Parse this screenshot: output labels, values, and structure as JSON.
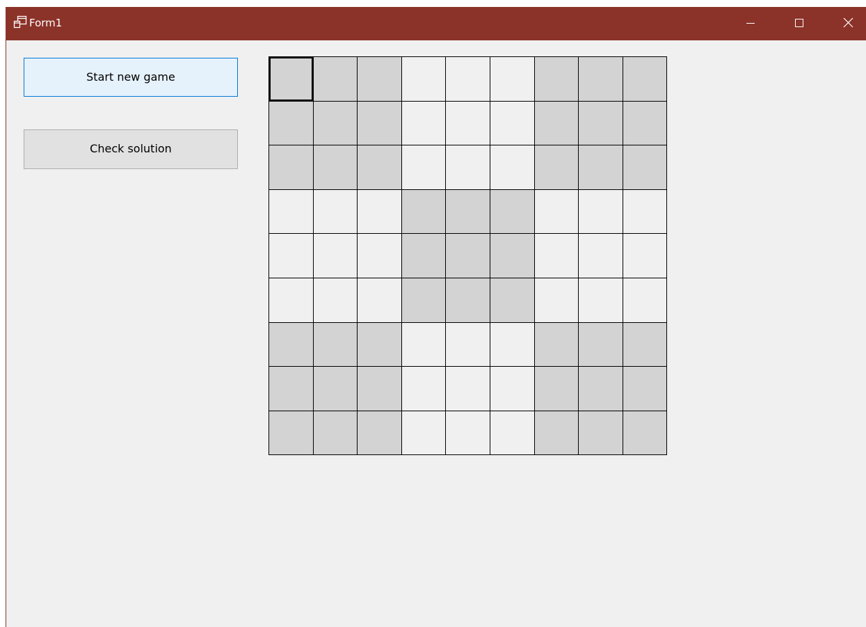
{
  "window": {
    "title": "Form1",
    "icon": "window-app-icon",
    "titlebar_color": "#8b3229",
    "controls": {
      "minimize_icon": "minimize-icon",
      "maximize_icon": "maximize-icon",
      "close_icon": "close-icon"
    }
  },
  "buttons": {
    "start_new_game": "Start new game",
    "check_solution": "Check solution"
  },
  "board": {
    "rows": 9,
    "cols": 9,
    "shaded_color": "#d3d3d3",
    "plain_color": "#f0f0f0",
    "selected_cell": [
      0,
      0
    ],
    "cell_values": [
      [
        "",
        "",
        "",
        "",
        "",
        "",
        "",
        "",
        ""
      ],
      [
        "",
        "",
        "",
        "",
        "",
        "",
        "",
        "",
        ""
      ],
      [
        "",
        "",
        "",
        "",
        "",
        "",
        "",
        "",
        ""
      ],
      [
        "",
        "",
        "",
        "",
        "",
        "",
        "",
        "",
        ""
      ],
      [
        "",
        "",
        "",
        "",
        "",
        "",
        "",
        "",
        ""
      ],
      [
        "",
        "",
        "",
        "",
        "",
        "",
        "",
        "",
        ""
      ],
      [
        "",
        "",
        "",
        "",
        "",
        "",
        "",
        "",
        ""
      ],
      [
        "",
        "",
        "",
        "",
        "",
        "",
        "",
        "",
        ""
      ],
      [
        "",
        "",
        "",
        "",
        "",
        "",
        "",
        "",
        ""
      ]
    ]
  }
}
